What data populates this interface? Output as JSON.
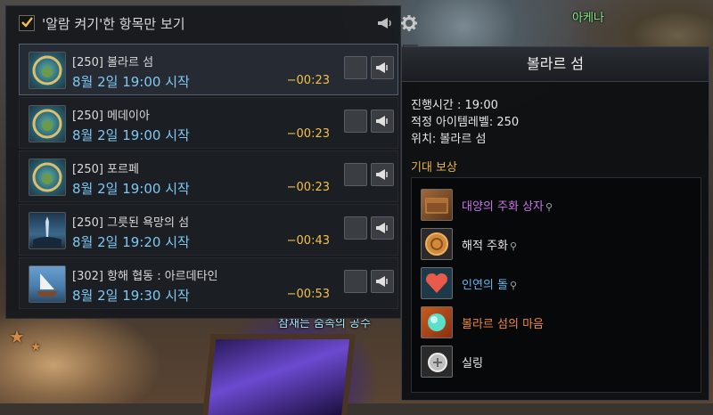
{
  "world": {
    "location_label": "아케나",
    "chat_text": "참재는 숨속의 공수"
  },
  "panel": {
    "filter_checked": true,
    "filter_label": "'알람 켜기'한 항목만 보기",
    "rows": [
      {
        "title": "[250] 볼라르 섬",
        "time": "8월 2일 19:00 시작",
        "countdown": "−00:23",
        "icon": "island-compass-icon",
        "selected": true
      },
      {
        "title": "[250] 메데이아",
        "time": "8월 2일 19:00 시작",
        "countdown": "−00:23",
        "icon": "island-compass-icon",
        "selected": false
      },
      {
        "title": "[250] 포르페",
        "time": "8월 2일 19:00 시작",
        "countdown": "−00:23",
        "icon": "island-compass-icon",
        "selected": false
      },
      {
        "title": "[250] 그릇된 욕망의 섬",
        "time": "8월 2일 19:20 시작",
        "countdown": "−00:43",
        "icon": "dark-island-icon",
        "selected": false
      },
      {
        "title": "[302] 항해 협동 : 아르데타인",
        "time": "8월 2일 19:30 시작",
        "countdown": "−00:53",
        "icon": "ship-icon",
        "selected": false
      }
    ]
  },
  "tooltip": {
    "title": "볼라르 섬",
    "duration": "진행시간 : 19:00",
    "item_level": "적정 아이템레벨: 250",
    "location": "위치: 볼라르 섬",
    "rewards_header": "기대 보상",
    "rewards": [
      {
        "name": "대양의 주화 상자",
        "color": "#c873e8",
        "bound": true,
        "icon": "coin-chest-icon"
      },
      {
        "name": "해적 주화",
        "color": "#e6e6e6",
        "bound": true,
        "icon": "pirate-coin-icon"
      },
      {
        "name": "인연의 돌",
        "color": "#5db7f0",
        "bound": true,
        "icon": "heart-stone-icon"
      },
      {
        "name": "볼라르 섬의 마음",
        "color": "#f08a3c",
        "bound": false,
        "icon": "island-heart-icon"
      },
      {
        "name": "실링",
        "color": "#e6e6e6",
        "bound": false,
        "icon": "silling-icon"
      }
    ]
  },
  "colors": {
    "accent_blue": "#7fc8f2",
    "countdown": "#f2c14a",
    "section": "#e8b54a"
  }
}
